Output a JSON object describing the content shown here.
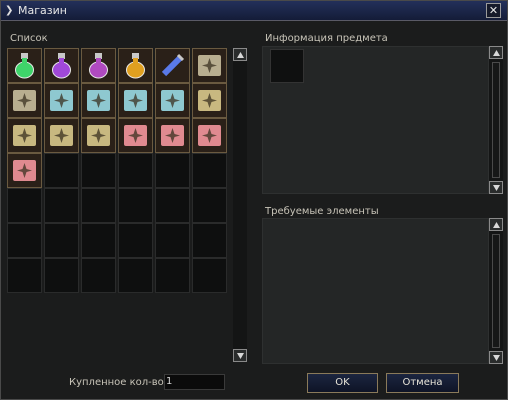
{
  "window": {
    "title": "Магазин",
    "chevron_icon": "chevron-right-icon",
    "close_icon": "close-x-icon"
  },
  "list": {
    "label": "Список",
    "items": [
      {
        "icon": "green-potion-icon",
        "color": "#3fd46a"
      },
      {
        "icon": "purple-potion-icon",
        "color": "#a048d8"
      },
      {
        "icon": "violet-elixir-icon",
        "color": "#b04ac0"
      },
      {
        "icon": "orange-elixir-icon",
        "color": "#e0a020"
      },
      {
        "icon": "blue-vial-icon",
        "color": "#5a7ae8"
      },
      {
        "icon": "beige-scroll-icon",
        "color": "#b8ae90"
      },
      {
        "icon": "beige-scroll-icon",
        "color": "#b8ae90"
      },
      {
        "icon": "cyan-scroll-icon",
        "color": "#8ec8d0"
      },
      {
        "icon": "cyan-scroll-icon",
        "color": "#8ec8d0"
      },
      {
        "icon": "cyan-scroll-icon",
        "color": "#8ec8d0"
      },
      {
        "icon": "cyan-scroll-icon",
        "color": "#8ec8d0"
      },
      {
        "icon": "tan-scroll-icon",
        "color": "#c8b880"
      },
      {
        "icon": "tan-scroll-icon",
        "color": "#c8b880"
      },
      {
        "icon": "tan-scroll-icon",
        "color": "#c8b880"
      },
      {
        "icon": "tan-scroll-icon",
        "color": "#c8b880"
      },
      {
        "icon": "pink-scroll-icon",
        "color": "#e08a90"
      },
      {
        "icon": "pink-scroll-icon",
        "color": "#e08a90"
      },
      {
        "icon": "pink-scroll-icon",
        "color": "#e08a90"
      },
      {
        "icon": "pink-scroll-icon",
        "color": "#e08a90"
      }
    ],
    "total_slots": 42
  },
  "item_info": {
    "label": "Информация предмета"
  },
  "required": {
    "label": "Требуемые элементы"
  },
  "purchase": {
    "qty_label": "Купленное кол-во",
    "qty_value": "1",
    "ok_label": "OK",
    "cancel_label": "Отмена"
  },
  "colors": {
    "titlebar": "#1c2648",
    "background": "#1b1c1c",
    "panel": "#242626",
    "button_border": "#8a7a5a"
  }
}
